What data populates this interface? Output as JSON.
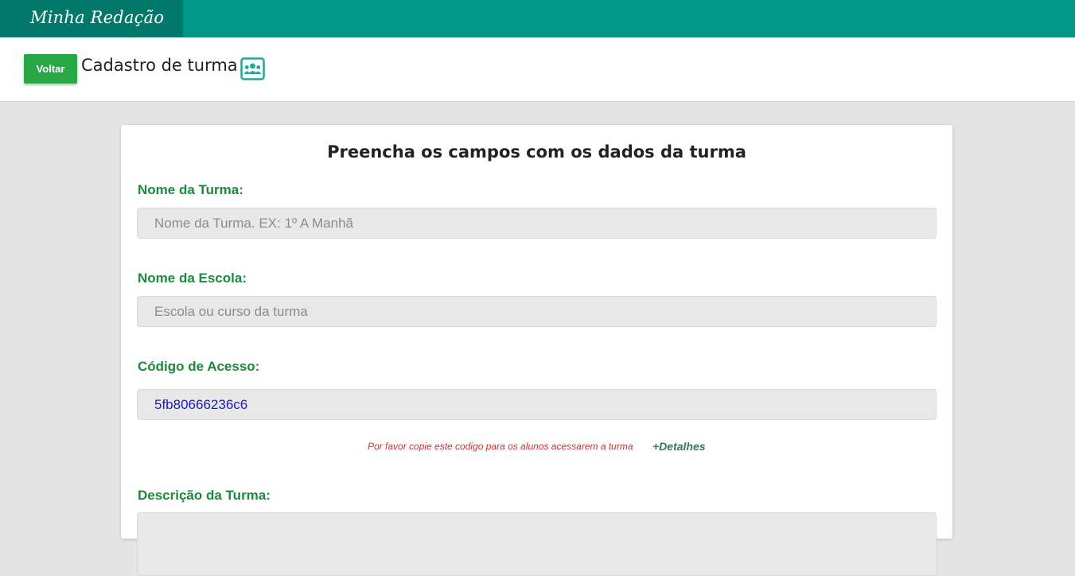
{
  "app": {
    "brand": "Minha Redação"
  },
  "header": {
    "back_label": "Voltar",
    "title": "Cadastro de turma",
    "title_icon": "classroom-icon"
  },
  "form": {
    "heading": "Preencha os campos com os dados da turma",
    "class_name": {
      "label": "Nome da Turma:",
      "value": "",
      "placeholder": "Nome da Turma. EX: 1º A Manhã"
    },
    "school_name": {
      "label": "Nome da Escola:",
      "value": "",
      "placeholder": "Escola ou curso da turma"
    },
    "access_code": {
      "label": "Código de Acesso:",
      "value": "5fb80666236c6",
      "hint": "Por favor copie este codigo para os alunos acessarem a turma",
      "details_link": "+Detalhes"
    },
    "description": {
      "label": "Descrição da Turma:"
    }
  },
  "colors": {
    "topbar": "#009688",
    "brand_bg": "#00796b",
    "button": "#28a745",
    "label": "#1a8a3c",
    "hint": "#d32f2f",
    "code": "#1a1acc"
  }
}
